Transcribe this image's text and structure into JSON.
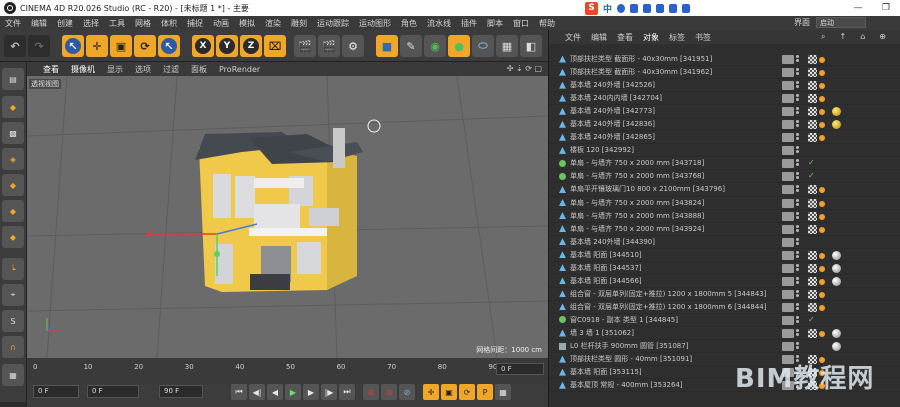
{
  "window": {
    "title": "CINEMA 4D R20.026 Studio (RC - R20) - [未标题 1 *] - 主要",
    "controls": [
      "—",
      "❐"
    ]
  },
  "ime": {
    "label": "中"
  },
  "menu": [
    "文件",
    "编辑",
    "创建",
    "选择",
    "工具",
    "网格",
    "体积",
    "捕捉",
    "动画",
    "模拟",
    "渲染",
    "雕刻",
    "运动跟踪",
    "运动图形",
    "角色",
    "流水线",
    "插件",
    "脚本",
    "窗口",
    "帮助"
  ],
  "layout": {
    "label": "界面",
    "value": "启动"
  },
  "viewport": {
    "menu": [
      "查看",
      "摄像机",
      "显示",
      "选项",
      "过滤",
      "面板",
      "ProRender"
    ],
    "label": "透视视图",
    "grid_info": "网格间距：1000 cm",
    "nav": "✣ ⇣ ⟳ ▢"
  },
  "timeline": {
    "ticks": [
      "0",
      "10",
      "20",
      "30",
      "40",
      "50",
      "60",
      "70",
      "80",
      "90"
    ],
    "frame": "0 F"
  },
  "transport": {
    "start": "0 F",
    "min": "0 F",
    "max": "90 F",
    "end": "90 F"
  },
  "objects": {
    "menu": [
      "文件",
      "编辑",
      "查看",
      "对象",
      "标签",
      "书签"
    ],
    "rows": [
      {
        "name": "顶部扶栏类型 截面形 - 40x30mm [341951]",
        "icon": "tri",
        "tags": [
          "chk",
          "org"
        ]
      },
      {
        "name": "顶部扶栏类型 截面形 - 40x30mm [341962]",
        "icon": "tri",
        "tags": [
          "chk",
          "org"
        ]
      },
      {
        "name": "基本墙 240外墙 [342526]",
        "icon": "tri",
        "tags": [
          "chk",
          "org"
        ]
      },
      {
        "name": "基本墙 240内内墙 [342704]",
        "icon": "tri",
        "tags": [
          "chk",
          "org"
        ]
      },
      {
        "name": "基本墙 240外墙 [342773]",
        "icon": "tri",
        "tags": [
          "chk",
          "org",
          "gld"
        ]
      },
      {
        "name": "基本墙 240外墙 [342836]",
        "icon": "tri",
        "tags": [
          "chk",
          "org",
          "gld"
        ]
      },
      {
        "name": "基本墙 240外墙 [342865]",
        "icon": "tri",
        "tags": [
          "chk",
          "org"
        ]
      },
      {
        "name": "楼板 120 [342992]",
        "icon": "tri",
        "tags": []
      },
      {
        "name": "单扇 - 与墙齐 750 x 2000 mm [343718]",
        "icon": "green",
        "tags": [
          "tick"
        ]
      },
      {
        "name": "单扇 - 与墙齐 750 x 2000 mm [343768]",
        "icon": "green",
        "tags": [
          "tick"
        ]
      },
      {
        "name": "单扇平开镶玻璃门10 800 x 2100mm [343796]",
        "icon": "tri",
        "tags": [
          "chk",
          "org"
        ]
      },
      {
        "name": "单扇 - 与墙齐 750 x 2000 mm [343824]",
        "icon": "tri",
        "tags": [
          "chk",
          "org"
        ]
      },
      {
        "name": "单扇 - 与墙齐 750 x 2000 mm [343888]",
        "icon": "tri",
        "tags": [
          "chk",
          "org"
        ]
      },
      {
        "name": "单扇 - 与墙齐 750 x 2000 mm [343924]",
        "icon": "tri",
        "tags": [
          "chk",
          "org"
        ]
      },
      {
        "name": "基本墙 240外墙 [344390]",
        "icon": "tri",
        "tags": []
      },
      {
        "name": "基本墙 阳面 [344510]",
        "icon": "tri",
        "tags": [
          "chk",
          "org",
          "sph"
        ]
      },
      {
        "name": "基本墙 阳面 [344537]",
        "icon": "tri",
        "tags": [
          "chk",
          "org",
          "sph"
        ]
      },
      {
        "name": "基本墙 阳面 [344566]",
        "icon": "tri",
        "tags": [
          "chk",
          "org",
          "sph"
        ]
      },
      {
        "name": "组合窗 - 双层单列(固定+推拉) 1200 x 1800mm 5 [344843]",
        "icon": "tri",
        "tags": [
          "chk",
          "org"
        ]
      },
      {
        "name": "组合窗 - 双层单列(固定+推拉) 1200 x 1800mm 6 [344844]",
        "icon": "tri",
        "tags": [
          "chk",
          "org"
        ]
      },
      {
        "name": "窗C0918 - 副本 类型 1 [344845]",
        "icon": "green",
        "tags": [
          "tick"
        ]
      },
      {
        "name": "墙 3 墙 1 [351062]",
        "icon": "tri",
        "tags": [
          "chk",
          "org",
          "sph"
        ]
      },
      {
        "name": "L0 栏杆扶手 900mm 圆管 [351087]",
        "icon": "sq",
        "tags": [
          "sph"
        ]
      },
      {
        "name": "顶部扶栏类型 圆形 - 40mm [351091]",
        "icon": "tri",
        "tags": [
          "chk",
          "org"
        ]
      },
      {
        "name": "基本墙 阳面 [353115]",
        "icon": "tri",
        "tags": [
          "chk",
          "org"
        ]
      },
      {
        "name": "基本屋顶 常规 - 400mm [353264]",
        "icon": "tri",
        "tags": [
          "chk",
          "org"
        ]
      }
    ]
  },
  "watermark": {
    "text": "BIM教程网"
  },
  "colors": {
    "bg": "#3c3c3c",
    "viewport": "#6b6b6b",
    "house_wall": "#f1c94a",
    "roof": "#4a4d52",
    "accent": "#f2a02b"
  }
}
